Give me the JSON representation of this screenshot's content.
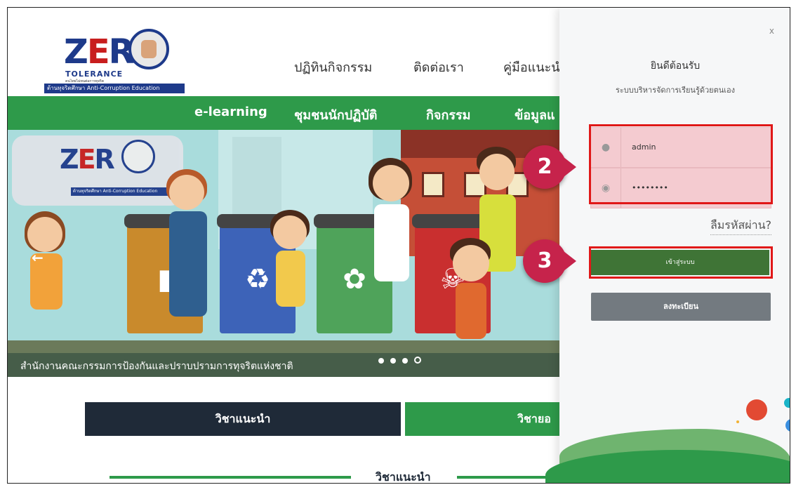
{
  "logo": {
    "zero_text": "ZERO",
    "tolerance": "TOLERANCE",
    "tagline": "คนไทยไม่ทนต่อการทุจริต",
    "bar_text": "ต้านทุจริตศึกษา  Anti-Corruption Education"
  },
  "top_nav": {
    "items": [
      "ปฏิทินกิจกรรม",
      "ติดต่อเรา",
      "คู่มือแนะนำ"
    ]
  },
  "green_nav": {
    "items": [
      "e-learning",
      "ชุมชนนักปฏิบัติ",
      "กิจกรรม",
      "ข้อมูลแ"
    ]
  },
  "hero": {
    "caption": "สำนักงานคณะกรรมการป้องกันและปราบปรามการทุจริตแห่งชาติ",
    "prev_arrow": "←",
    "slides_total": 4,
    "slide_active": 4
  },
  "tabs": {
    "tab1": "วิชาแนะนำ",
    "tab2": "วิชายอ"
  },
  "section_title": "วิชาแนะนำ",
  "login": {
    "close": "x",
    "welcome": "ยินดีต้อนรับ",
    "subtitle": "ระบบบริหารจัดการเรียนรู้ด้วยตนเอง",
    "username_value": "admin",
    "password_value": "••••••••",
    "forgot": "ลืมรหัสผ่าน?",
    "login_button": "เข้าสู่ระบบ",
    "register_button": "ลงทะเบียน"
  },
  "annotations": {
    "step2": "2",
    "step3": "3",
    "highlight_color": "#e01818",
    "badge_color": "#c6234b"
  },
  "colors": {
    "brand_green": "#2e9a4a",
    "dark_navy": "#1f2a38",
    "login_green": "#3f7436",
    "register_gray": "#737a80",
    "input_pink": "#f4cbd0"
  }
}
